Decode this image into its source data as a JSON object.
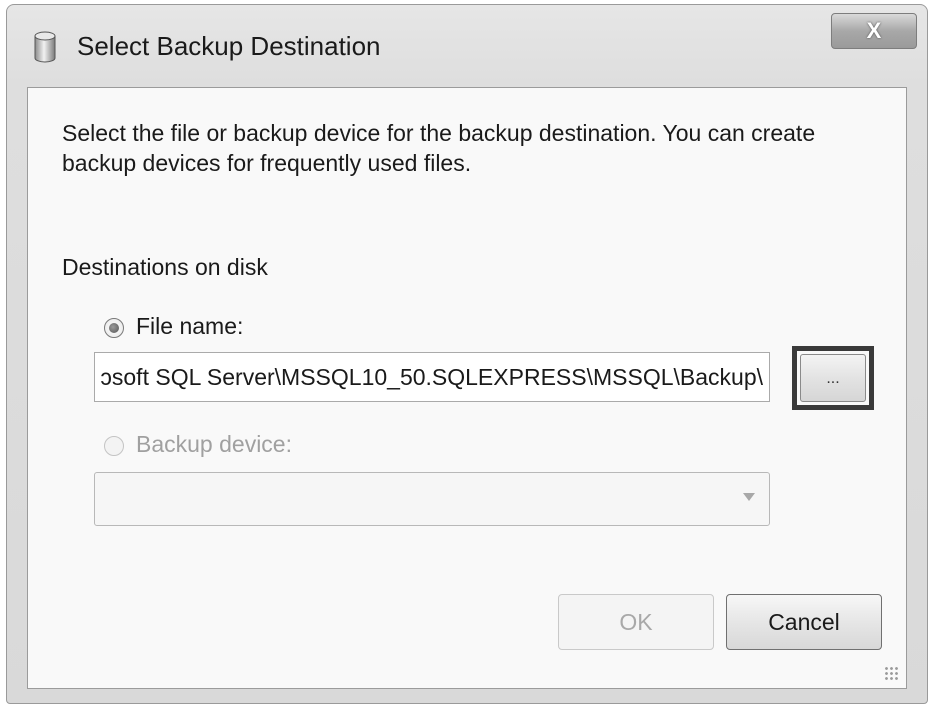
{
  "window": {
    "title": "Select Backup Destination",
    "title_icon": "database-icon",
    "close_label": "X",
    "close_icon": "close-icon"
  },
  "content": {
    "description": "Select the file or backup device for the backup destination. You can create backup devices for frequently used files.",
    "section_label": "Destinations on disk"
  },
  "destinations": {
    "file_name": {
      "label": "File name:",
      "selected": true,
      "value": "ɔsoft SQL Server\\MSSQL10_50.SQLEXPRESS\\MSSQL\\Backup\\",
      "browse_label": "..."
    },
    "backup_device": {
      "label": "Backup device:",
      "selected": false,
      "enabled": false,
      "value": ""
    }
  },
  "buttons": {
    "ok_label": "OK",
    "ok_enabled": false,
    "cancel_label": "Cancel"
  },
  "colors": {
    "disabled_text": "#a0a0a0",
    "highlight_border": "#3a3a3a"
  }
}
